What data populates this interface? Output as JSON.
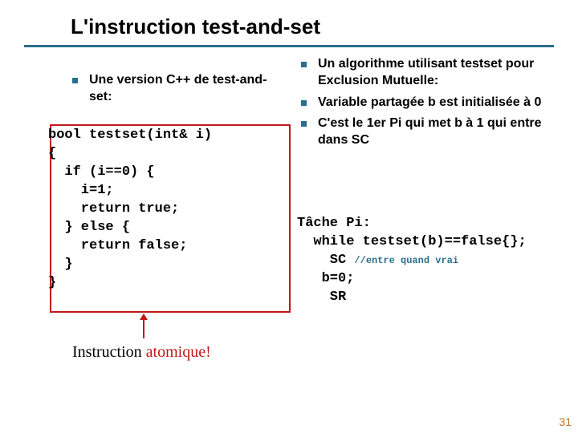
{
  "title": "L'instruction test-and-set",
  "left_bullet": "Une version C++  de test-and-set:",
  "code_left": "bool testset(int& i)\n{\n  if (i==0) {\n    i=1;\n    return true;\n  } else {\n    return false;\n  }\n}",
  "right_bullets": [
    "Un algorithme utilisant testset pour Exclusion Mutuelle:",
    "Variable partagée b est initialisée à 0",
    "C'est le 1er Pi qui met b à 1 qui entre dans SC"
  ],
  "code_right_pre": "Tâche Pi:\n  while testset(b)==false{};\n    SC ",
  "code_right_comment": "//entre quand vrai",
  "code_right_post": "\n   b=0;\n    SR",
  "caption_plain": "Instruction ",
  "caption_red": "atomique!",
  "page_number": "31"
}
